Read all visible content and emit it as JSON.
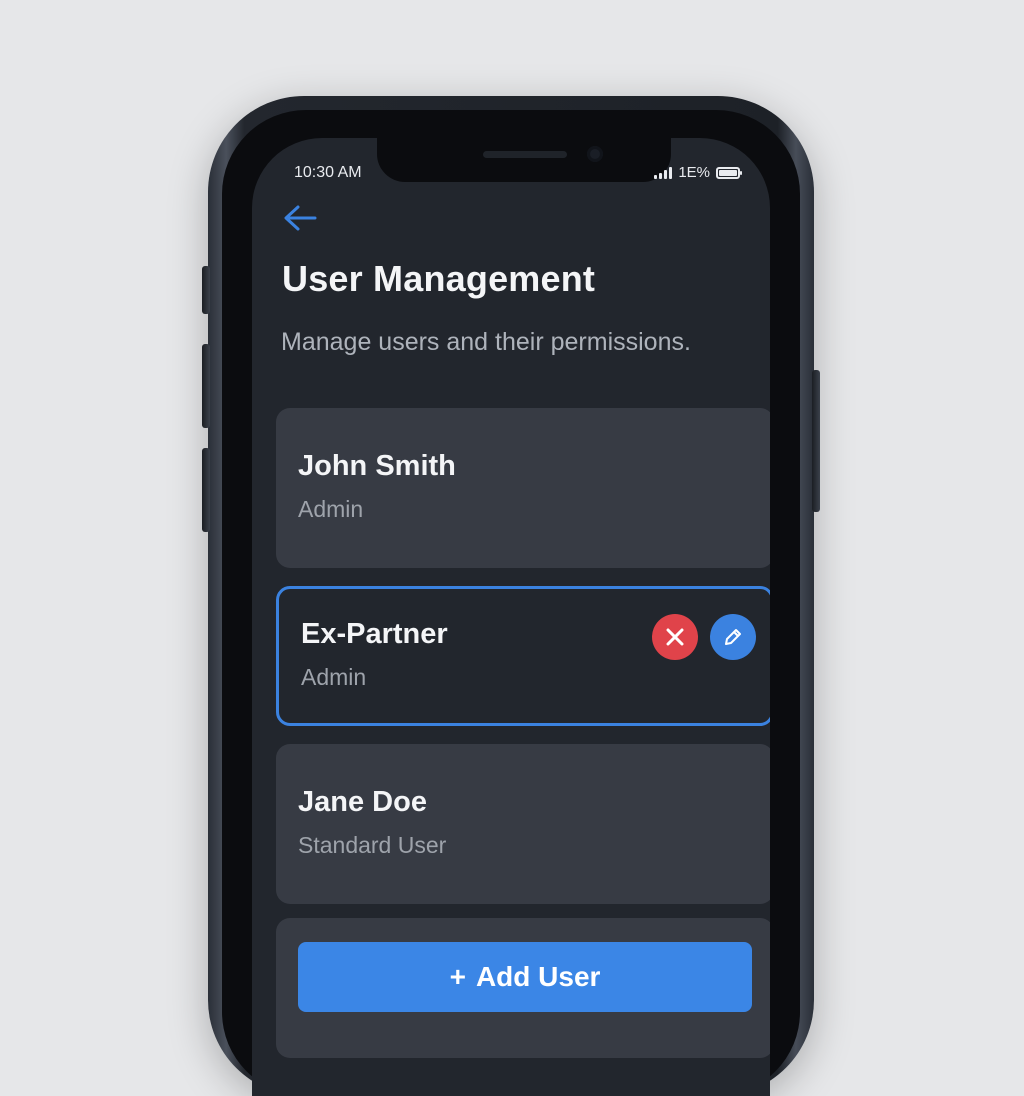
{
  "status_bar": {
    "time": "10:30 AM",
    "battery_text": "1E%"
  },
  "header": {
    "title": "User Management",
    "subtitle": "Manage users and their permissions."
  },
  "users": [
    {
      "name": "John Smith",
      "role": "Admin",
      "selected": false
    },
    {
      "name": "Ex-Partner",
      "role": "Admin",
      "selected": true
    },
    {
      "name": "Jane Doe",
      "role": "Standard User",
      "selected": false
    }
  ],
  "actions": {
    "add_user_plus": "+",
    "add_user_label": "Add User"
  },
  "icons": {
    "back": "back-arrow-icon",
    "delete": "close-icon",
    "edit": "pencil-icon",
    "signal": "signal-bars-icon",
    "battery": "battery-icon"
  },
  "colors": {
    "accent": "#3b82e0",
    "danger": "#e0434a",
    "screen_bg": "#22262d",
    "card_bg": "#373b44"
  }
}
